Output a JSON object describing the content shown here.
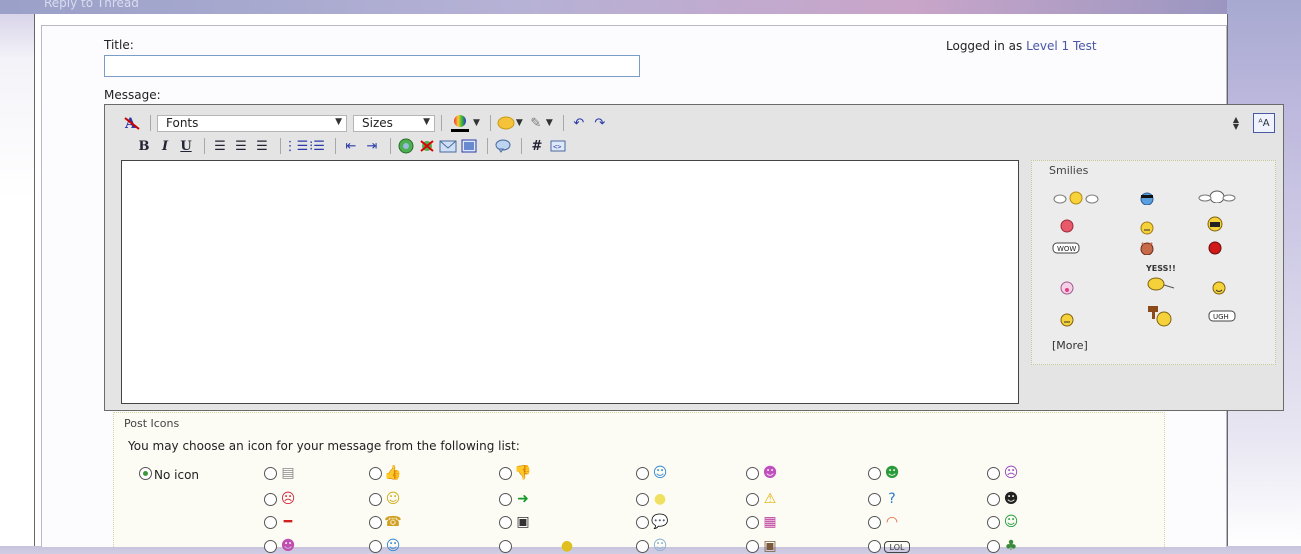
{
  "breadcrumb": "Reply to Thread",
  "labels": {
    "title": "Title:",
    "message": "Message:"
  },
  "title_field": {
    "value": "",
    "placeholder": ""
  },
  "login": {
    "prefix": "Logged in as",
    "user": "Level 1 Test"
  },
  "toolbar": {
    "font_select": "Fonts",
    "size_select": "Sizes",
    "row1_icons": [
      "remove-format-icon",
      "text-color-icon",
      "smilie-insert-icon",
      "attachment-icon",
      "undo-icon",
      "redo-icon"
    ],
    "row2_icons": [
      "bold-icon",
      "italic-icon",
      "underline-icon",
      "align-left-icon",
      "align-center-icon",
      "align-right-icon",
      "ordered-list-icon",
      "unordered-list-icon",
      "outdent-icon",
      "indent-icon",
      "insert-link-icon",
      "unlink-icon",
      "insert-email-icon",
      "insert-image-icon",
      "quote-icon",
      "hashtag-icon",
      "code-icon"
    ],
    "bold_glyph": "B",
    "italic_glyph": "I",
    "underline_glyph": "U",
    "hash_glyph": "#",
    "aa_glyph": "ᴬA"
  },
  "message": {
    "value": ""
  },
  "smilies": {
    "legend": "Smilies",
    "yess_text": "YESS!!",
    "more_link": "[More]",
    "items": [
      "wave-smilie",
      "cool-smilie",
      "angel-smilie",
      "mad-smilie",
      "neutral-smilie",
      "yell-smilie",
      "wow-smilie",
      "devil-smilie",
      "angry-red-smilie",
      "kiss-smilie",
      "yess-smilie",
      "happy-smilie",
      "eek-smilie",
      "hammer-smilie",
      "ugh-smilie"
    ]
  },
  "post_icons": {
    "legend": "Post Icons",
    "description": "You may choose an icon for your message from the following list:",
    "no_icon_label": "No icon",
    "selected": "No icon",
    "icons": [
      "doc",
      "thumbs-up",
      "thumbs-down",
      "wink",
      "grin-purple",
      "teeth",
      "sad",
      "mad",
      "smile",
      "arrow-right",
      "lightbulb",
      "warning",
      "question",
      "cool",
      "dash",
      "phone",
      "camera",
      "speech",
      "rainbow-box",
      "rainbow",
      "wave-smile",
      "grin-pink",
      "laugh-blue",
      "blank-yellow",
      "angel",
      "tv-box",
      "lol",
      "clover"
    ]
  },
  "colors": {
    "link": "#4a56a8",
    "toolbar_bg": "#e4e4e4",
    "editor_border": "#6b6b6b",
    "input_border": "#7a9cc6"
  }
}
